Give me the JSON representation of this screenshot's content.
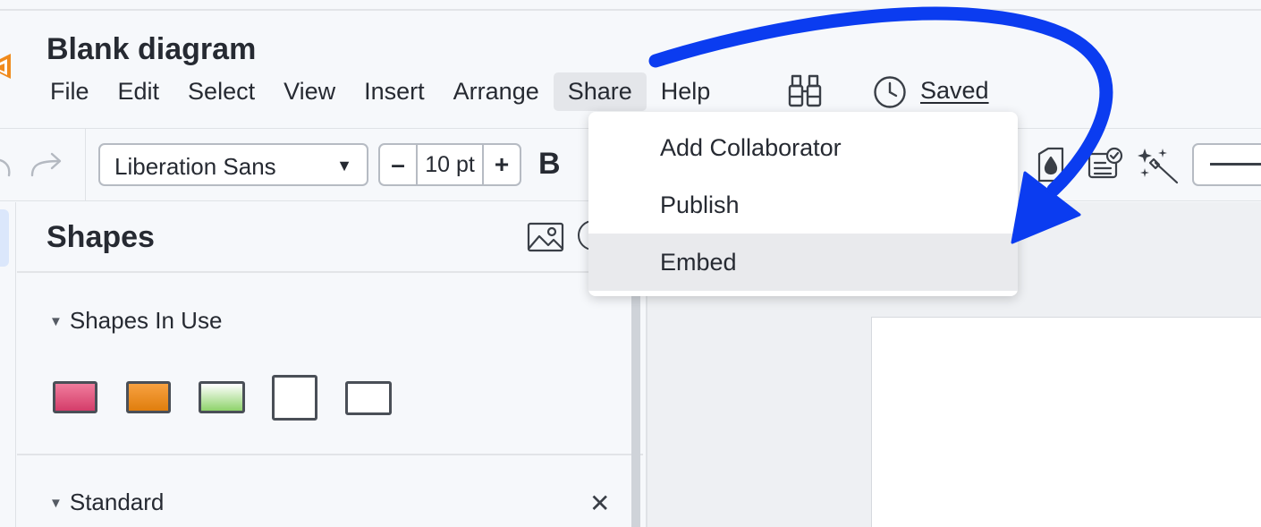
{
  "header": {
    "title": "Blank diagram",
    "saved_label": "Saved"
  },
  "menubar": {
    "items": [
      {
        "label": "File"
      },
      {
        "label": "Edit"
      },
      {
        "label": "Select"
      },
      {
        "label": "View"
      },
      {
        "label": "Insert"
      },
      {
        "label": "Arrange"
      },
      {
        "label": "Share",
        "active": true
      },
      {
        "label": "Help"
      }
    ]
  },
  "toolbar": {
    "font_family": "Liberation Sans",
    "size_minus": "–",
    "size_value": "10 pt",
    "size_plus": "+",
    "bold_label": "B",
    "icons": [
      "undo-icon",
      "redo-icon",
      "fill-color-icon",
      "format-check-icon",
      "magic-wand-icon"
    ]
  },
  "share_menu": {
    "items": [
      {
        "label": "Add Collaborator"
      },
      {
        "label": "Publish"
      },
      {
        "label": "Embed",
        "hovered": true
      }
    ]
  },
  "shapes_panel": {
    "title": "Shapes",
    "sections": [
      {
        "title": "Shapes In Use"
      },
      {
        "title": "Standard"
      }
    ],
    "swatches": [
      {
        "fill_top": "#f07c9c",
        "fill_bottom": "#d43d6a",
        "border": "#4a4f57"
      },
      {
        "fill_top": "#f7a141",
        "fill_bottom": "#e07e0d",
        "border": "#4a4f57"
      },
      {
        "fill_top": "#ffffff",
        "fill_bottom": "#8ed36b",
        "border": "#4a4f57"
      },
      {
        "fill_top": "#ffffff",
        "fill_bottom": "#ffffff",
        "border": "#4a4f57"
      },
      {
        "fill_top": "#ffffff",
        "fill_bottom": "#ffffff",
        "border": "#4a4f57"
      }
    ]
  },
  "colors": {
    "annotation_arrow": "#0b3cf0",
    "menu_active_bg": "#e4e6ea",
    "menu_hover_bg": "#e9eaed"
  }
}
